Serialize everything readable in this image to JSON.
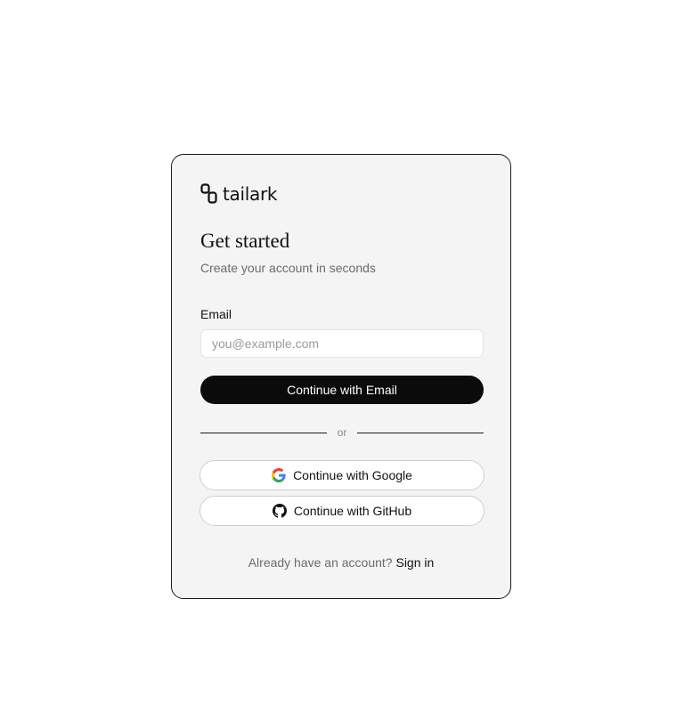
{
  "brand": {
    "name": "tailark",
    "logo_icon": "tailark-logo-icon"
  },
  "signup": {
    "title": "Get started",
    "subtitle": "Create your account in seconds",
    "email_label": "Email",
    "email_value": "",
    "email_placeholder": "you@example.com",
    "submit_label": "Continue with Email",
    "divider_text": "or"
  },
  "social": {
    "google_label": "Continue with Google",
    "google_icon": "google-icon",
    "github_label": "Continue with GitHub",
    "github_icon": "github-icon"
  },
  "footer": {
    "prompt": "Already have an account? ",
    "link_label": "Sign in"
  },
  "colors": {
    "card_background": "#f4f4f4",
    "primary_button": "#0b0b0b",
    "muted_text": "#6b6b6b"
  }
}
